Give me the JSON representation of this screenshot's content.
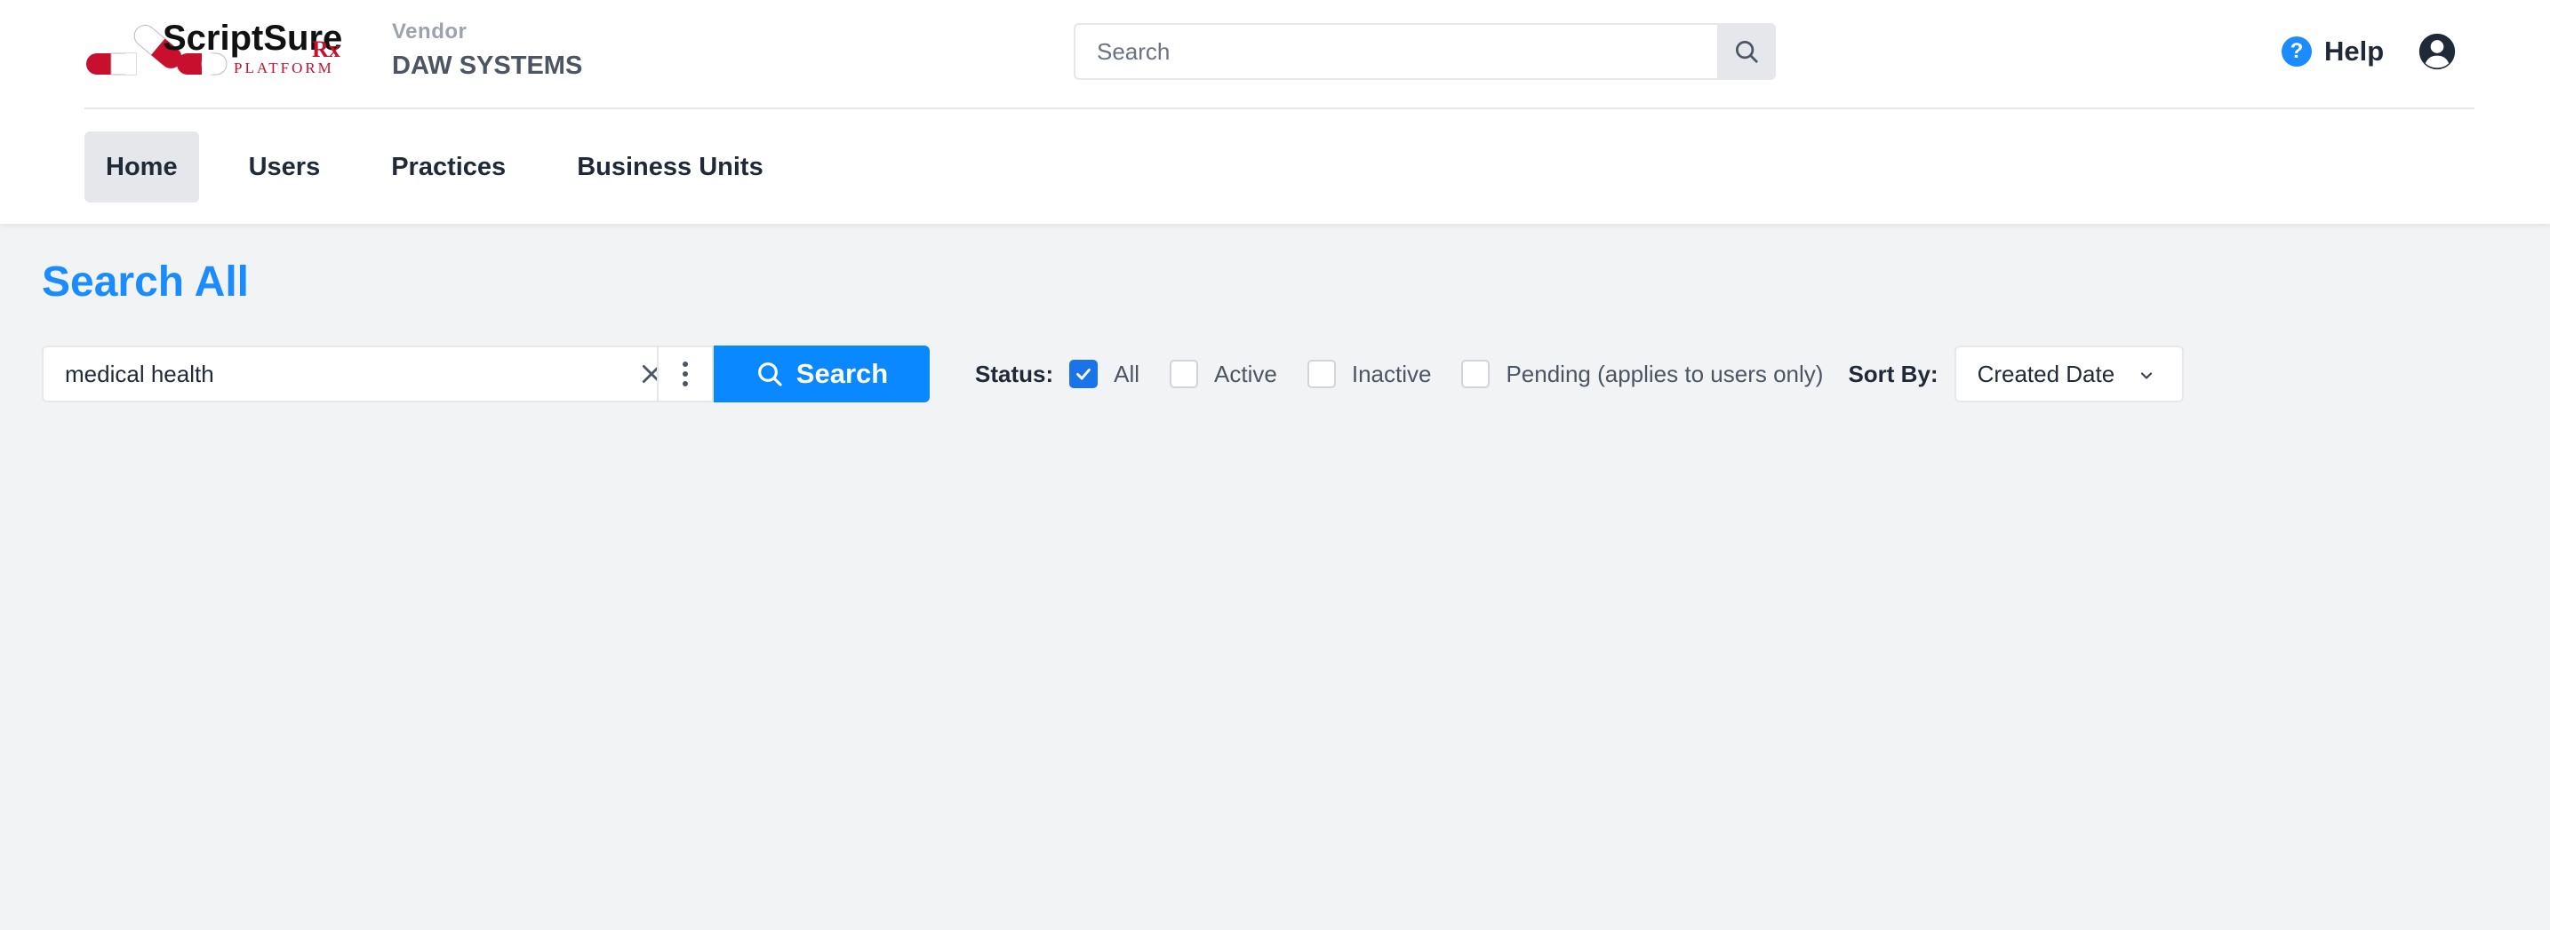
{
  "header": {
    "logo": {
      "brand": "ScriptSure",
      "rx": "Rx",
      "sub": "PLATFORM"
    },
    "vendor_label": "Vendor",
    "vendor_name": "DAW SYSTEMS",
    "search_placeholder": "Search",
    "help_label": "Help",
    "icons": {
      "search": "search-icon",
      "help": "help-circle-icon",
      "user": "user-circle-icon"
    }
  },
  "nav": {
    "items": [
      {
        "label": "Home",
        "active": true
      },
      {
        "label": "Users",
        "active": false
      },
      {
        "label": "Practices",
        "active": false
      },
      {
        "label": "Business Units",
        "active": false
      }
    ]
  },
  "main": {
    "title": "Search All",
    "query_value": "medical health",
    "search_button_label": "Search",
    "status": {
      "label": "Status:",
      "options": [
        {
          "label": "All",
          "checked": true
        },
        {
          "label": "Active",
          "checked": false
        },
        {
          "label": "Inactive",
          "checked": false
        },
        {
          "label": "Pending (applies to users only)",
          "checked": false
        }
      ]
    },
    "sort": {
      "label": "Sort By:",
      "selected": "Created Date"
    }
  },
  "colors": {
    "accent": "#0a88ff",
    "title": "#1a8cff",
    "checkbox_checked": "#1a73e8",
    "background": "#f2f3f5",
    "logo_red": "#c8102e"
  }
}
